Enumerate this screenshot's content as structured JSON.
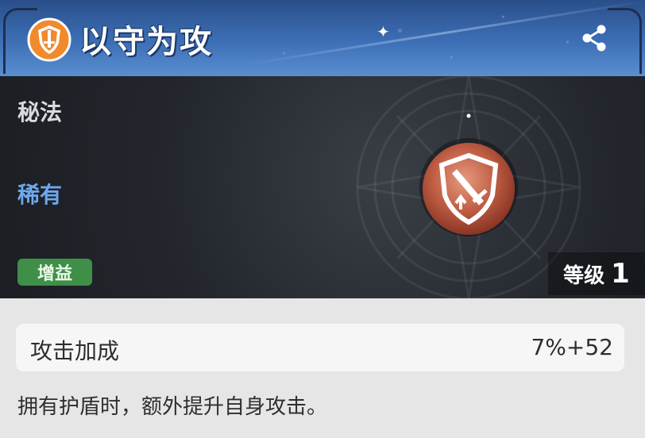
{
  "header": {
    "title": "以守为攻",
    "title_icon": "shield-sword-icon",
    "share_icon": "share-icon",
    "accent_color": "#3d6fb6"
  },
  "banner": {
    "category": "秘法",
    "rarity": "稀有",
    "tag": "增益",
    "level_label": "等级",
    "level_value": "1",
    "emblem_icon": "shield-sword-attack-up-icon",
    "rarity_color": "#6fa7ec",
    "tag_color": "#3f8f48"
  },
  "stat": {
    "name": "攻击加成",
    "value": "7%+52"
  },
  "description": "拥有护盾时，额外提升自身攻击。"
}
